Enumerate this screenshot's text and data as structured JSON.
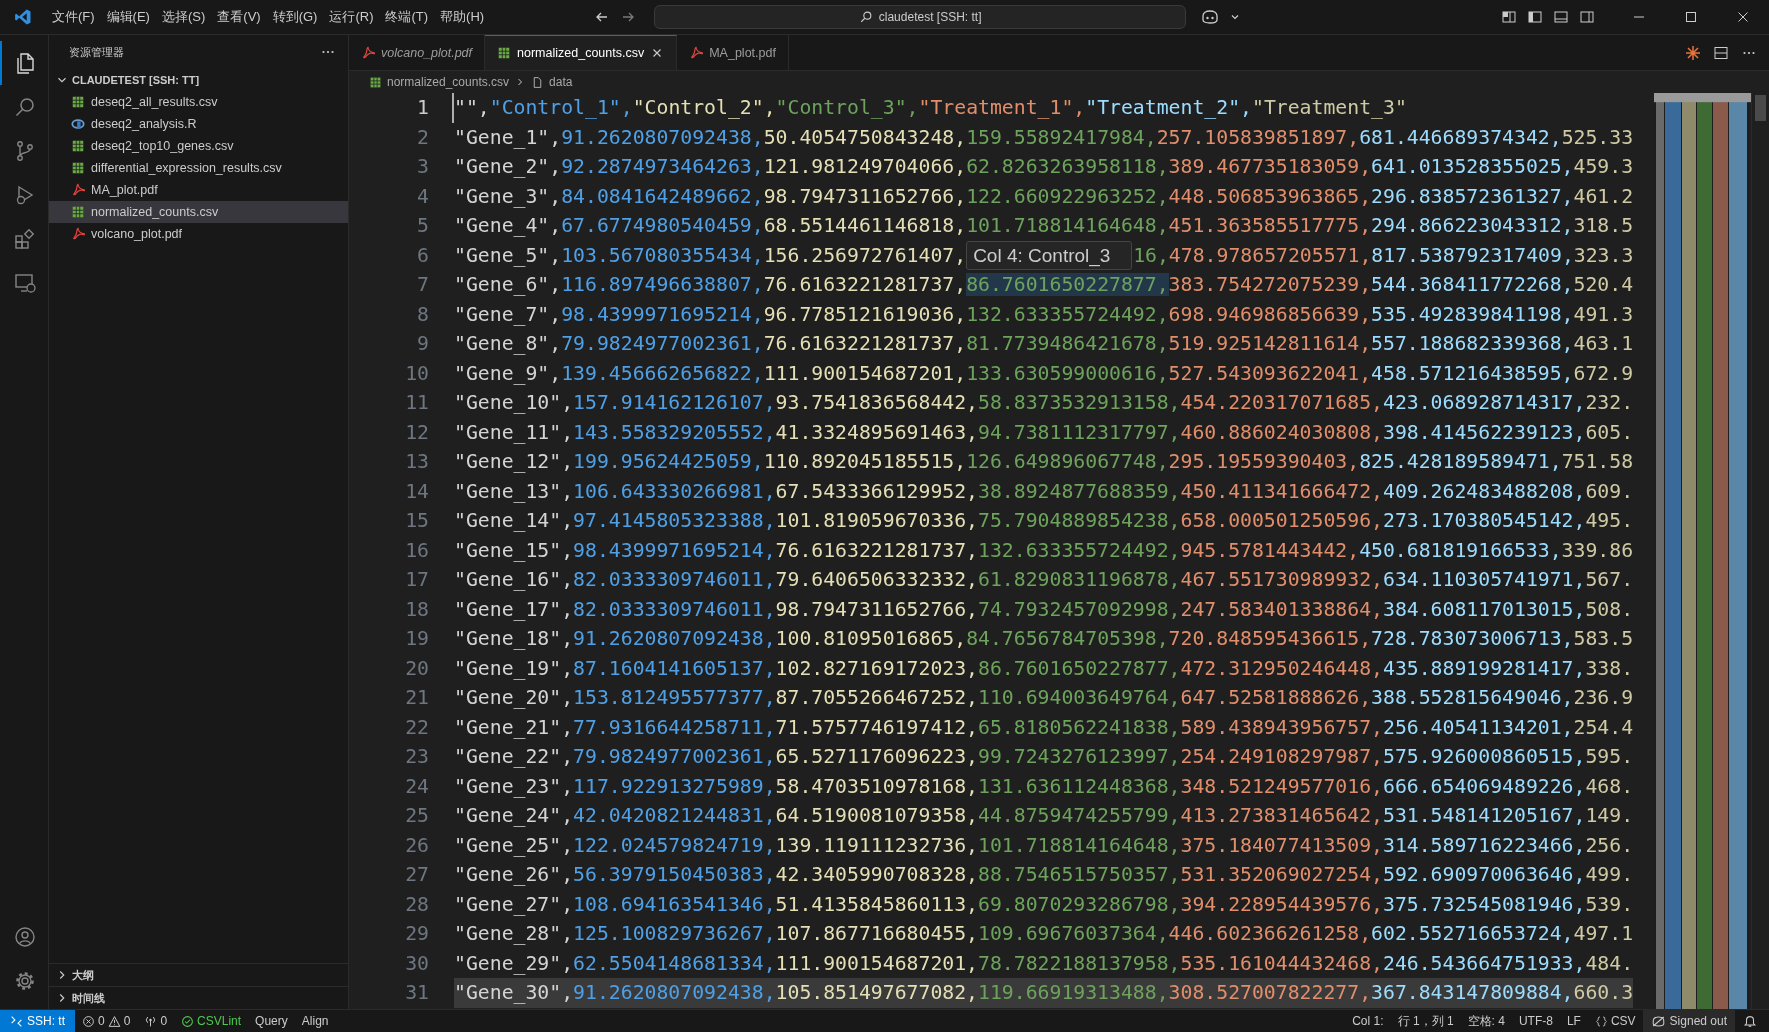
{
  "title_bar": {
    "menus": [
      "文件(F)",
      "编辑(E)",
      "选择(S)",
      "查看(V)",
      "转到(G)",
      "运行(R)",
      "终端(T)",
      "帮助(H)"
    ],
    "search": "claudetest [SSH: tt]"
  },
  "activity_bar": {
    "items": [
      {
        "kind": "files",
        "selected": true
      },
      {
        "kind": "search",
        "selected": false
      },
      {
        "kind": "branch",
        "selected": false
      },
      {
        "kind": "debug",
        "selected": false
      },
      {
        "kind": "extensions",
        "selected": false
      },
      {
        "kind": "remote",
        "selected": false
      }
    ],
    "bottom": [
      {
        "kind": "account"
      },
      {
        "kind": "settings"
      }
    ]
  },
  "sidebar": {
    "title": "资源管理器",
    "folder": {
      "label": "CLAUDETEST [SSH: TT]",
      "expanded": true,
      "children": [
        {
          "label": "deseq2_all_results.csv",
          "kind": "csv",
          "selected": false
        },
        {
          "label": "deseq2_analysis.R",
          "kind": "r",
          "selected": false
        },
        {
          "label": "deseq2_top10_genes.csv",
          "kind": "csv",
          "selected": false
        },
        {
          "label": "differential_expression_results.csv",
          "kind": "csv",
          "selected": false
        },
        {
          "label": "MA_plot.pdf",
          "kind": "pdf",
          "selected": false
        },
        {
          "label": "normalized_counts.csv",
          "kind": "csv",
          "selected": true
        },
        {
          "label": "volcano_plot.pdf",
          "kind": "pdf",
          "selected": false
        }
      ]
    },
    "sections": [
      {
        "label": "大纲",
        "expanded": false
      },
      {
        "label": "时间线",
        "expanded": false
      }
    ]
  },
  "tabs": [
    {
      "label": "volcano_plot.pdf",
      "kind": "pdf",
      "selected": false,
      "preview": true
    },
    {
      "label": "normalized_counts.csv",
      "kind": "csv",
      "selected": true,
      "preview": false
    },
    {
      "label": "MA_plot.pdf",
      "kind": "pdf",
      "selected": false,
      "preview": false
    }
  ],
  "breadcrumb": [
    {
      "label": "normalized_counts.csv",
      "kind": "csv"
    },
    {
      "label": "data",
      "kind": "field"
    }
  ],
  "editor": {
    "tooltip": "Col 4: Control_3",
    "lines": [
      {
        "number": "1",
        "kind": "current",
        "text": "\"\",\"Control_1\",\"Control_2\",\"Control_3\",\"Treatment_1\",\"Treatment_2\",\"Treatment_3\""
      },
      {
        "number": "2",
        "kind": "plain",
        "text": "\"Gene_1\",91.2620807092438,50.4054750843248,159.55892417984,257.105839851897,681.446689374342,525.33"
      },
      {
        "number": "3",
        "kind": "plain",
        "text": "\"Gene_2\",92.2874973464263,121.981249704066,62.8263263958118,389.467735183059,641.013528355025,459.3"
      },
      {
        "number": "4",
        "kind": "plain",
        "text": "\"Gene_3\",84.0841642489662,98.7947311652766,122.660922963252,448.506853963865,296.838572361327,461.2"
      },
      {
        "number": "5",
        "kind": "plain",
        "text": "\"Gene_4\",67.6774980540459,68.5514461146818,101.718814164648,451.363585517775,294.866223043312,318.5"
      },
      {
        "number": "6",
        "kind": "covered",
        "text": "\"Gene_5\",103.567080355434,156.256972761407,",
        "text_after": "16,478.978657205571,817.538792317409,323.3"
      },
      {
        "number": "7",
        "kind": "hovered",
        "text": "\"Gene_6\",116.897496638807,76.6163221281737,86.7601650227877,383.754272075239,544.368411772268,520.4"
      },
      {
        "number": "8",
        "kind": "plain",
        "text": "\"Gene_7\",98.4399971695214,96.7785121619036,132.633355724492,698.946986856639,535.492839841198,491.3"
      },
      {
        "number": "9",
        "kind": "plain",
        "text": "\"Gene_8\",79.9824977002361,76.6163221281737,81.7739486421678,519.925142811614,557.188682339368,463.1"
      },
      {
        "number": "10",
        "kind": "plain",
        "text": "\"Gene_9\",139.456662656822,111.900154687201,133.630599000616,527.543093622041,458.571216438595,672.9"
      },
      {
        "number": "11",
        "kind": "plain",
        "text": "\"Gene_10\",157.914162126107,93.7541836568442,58.8373532913158,454.220317071685,423.068928714317,232."
      },
      {
        "number": "12",
        "kind": "plain",
        "text": "\"Gene_11\",143.558329205552,41.3324895691463,94.7381112317797,460.886024030808,398.414562239123,605."
      },
      {
        "number": "13",
        "kind": "plain",
        "text": "\"Gene_12\",199.95624425059,110.892045185515,126.649896067748,295.19559390403,825.428189589471,751.58"
      },
      {
        "number": "14",
        "kind": "plain",
        "text": "\"Gene_13\",106.643330266981,67.5433366129952,38.8924877688359,450.411341666472,409.262483488208,609."
      },
      {
        "number": "15",
        "kind": "plain",
        "text": "\"Gene_14\",97.4145805323388,101.819059670336,75.7904889854238,658.000501250596,273.170380545142,495."
      },
      {
        "number": "16",
        "kind": "plain",
        "text": "\"Gene_15\",98.4399971695214,76.6163221281737,132.633355724492,945.5781443442,450.681819166533,339.86"
      },
      {
        "number": "17",
        "kind": "plain",
        "text": "\"Gene_16\",82.0333309746011,79.6406506332332,61.8290831196878,467.551730989932,634.110305741971,567."
      },
      {
        "number": "18",
        "kind": "plain",
        "text": "\"Gene_17\",82.0333309746011,98.7947311652766,74.7932457092998,247.583401338864,384.608117013015,508."
      },
      {
        "number": "19",
        "kind": "plain",
        "text": "\"Gene_18\",91.2620807092438,100.81095016865,84.7656784705398,720.848595436615,728.783073006713,583.5"
      },
      {
        "number": "20",
        "kind": "plain",
        "text": "\"Gene_19\",87.1604141605137,102.827169172023,86.7601650227877,472.312950246448,435.889199281417,338."
      },
      {
        "number": "21",
        "kind": "plain",
        "text": "\"Gene_20\",153.812495577377,87.7055266467252,110.694003649764,647.52581888626,388.552815649046,236.9"
      },
      {
        "number": "22",
        "kind": "plain",
        "text": "\"Gene_21\",77.9316644258711,71.5757746197412,65.8180562241838,589.438943956757,256.40541134201,254.4"
      },
      {
        "number": "23",
        "kind": "plain",
        "text": "\"Gene_22\",79.9824977002361,65.5271176096223,99.7243276123997,254.249108297987,575.926000860515,595."
      },
      {
        "number": "24",
        "kind": "plain",
        "text": "\"Gene_23\",117.922913275989,58.4703510978168,131.636112448368,348.521249577016,666.654069489226,468."
      },
      {
        "number": "25",
        "kind": "plain",
        "text": "\"Gene_24\",42.0420821244831,64.5190081079358,44.8759474255799,413.273831465642,531.548141205167,149."
      },
      {
        "number": "26",
        "kind": "plain",
        "text": "\"Gene_25\",122.024579824719,139.119111232736,101.718814164648,375.184077413509,314.589716223466,256."
      },
      {
        "number": "27",
        "kind": "plain",
        "text": "\"Gene_26\",56.3979150450383,42.3405990708328,88.7546515750357,531.352069027254,592.690970063646,499."
      },
      {
        "number": "28",
        "kind": "plain",
        "text": "\"Gene_27\",108.694163541346,51.4135845860113,69.8070293286798,394.228954439576,375.732545081946,539."
      },
      {
        "number": "29",
        "kind": "plain",
        "text": "\"Gene_28\",125.100829736267,107.867716680455,109.69676037364,446.602366261258,602.552716653724,497.1"
      },
      {
        "number": "30",
        "kind": "plain",
        "text": "\"Gene_29\",62.5504148681334,111.900154687201,78.7822188137958,535.161044432468,246.543664751933,484."
      },
      {
        "number": "31",
        "kind": "shaded",
        "text": "\"Gene_30\",91.2620807092438,105.851497677082,119.66919313488,308.527007822277,367.843147809884,660.3"
      }
    ]
  },
  "status_bar": {
    "remote": "SSH: tt",
    "errors": "0",
    "warnings": "0",
    "ports": "0",
    "left_items": [
      {
        "label": "CSVLint",
        "kind": "check"
      },
      {
        "label": "Query",
        "kind": "plain"
      },
      {
        "label": "Align",
        "kind": "plain"
      }
    ],
    "right_items": [
      {
        "label": "Col 1:",
        "kind": "plain"
      },
      {
        "label": "行 1，列 1",
        "kind": "plain"
      },
      {
        "label": "空格: 4",
        "kind": "plain"
      },
      {
        "label": "UTF-8",
        "kind": "plain"
      },
      {
        "label": "LF",
        "kind": "plain"
      },
      {
        "label": "CSV",
        "kind": "braces"
      }
    ],
    "account": "Signed out"
  }
}
